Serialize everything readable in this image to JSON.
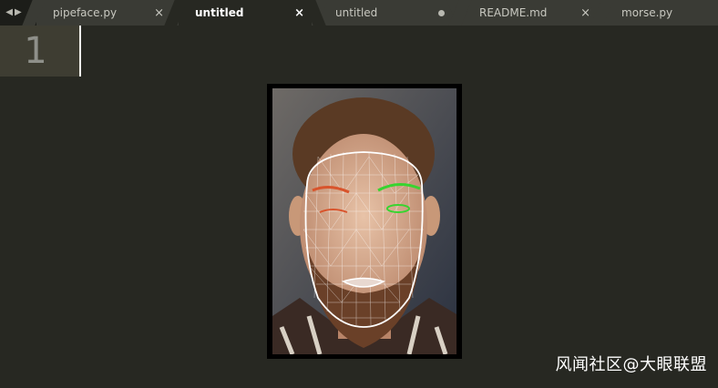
{
  "tabs": [
    {
      "label": "pipeface.py",
      "state": "close"
    },
    {
      "label": "untitled",
      "state": "close",
      "active": true
    },
    {
      "label": "untitled",
      "state": "modified"
    },
    {
      "label": "README.md",
      "state": "close"
    },
    {
      "label": "morse.py",
      "state": "none"
    }
  ],
  "close_glyph": "×",
  "nav": {
    "back": "◀",
    "forward": "▶"
  },
  "editor": {
    "line_number": "1"
  },
  "watermark": "风闻社区@大眼联盟",
  "colors": {
    "editor_bg": "#272822",
    "tab_bg": "#3a3b35",
    "mesh": "#ffffff",
    "eye_highlight": "#38d430",
    "eye_closed": "#d8542c"
  }
}
